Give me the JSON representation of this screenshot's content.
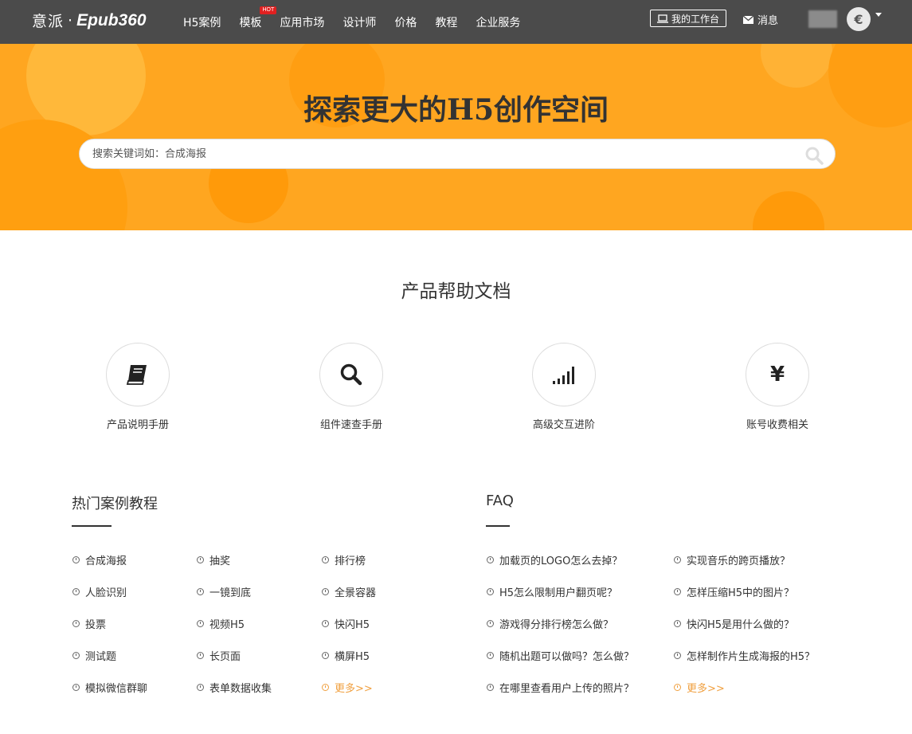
{
  "nav": {
    "logo_cn": "意派",
    "logo_dot": "·",
    "logo_en": "Epub360",
    "items": [
      {
        "label": "H5案例"
      },
      {
        "label": "模板",
        "badge": "HOT"
      },
      {
        "label": "应用市场"
      },
      {
        "label": "设计师"
      },
      {
        "label": "价格"
      },
      {
        "label": "教程"
      },
      {
        "label": "企业服务"
      }
    ],
    "workbench_label": "我的工作台",
    "messages_label": "消息",
    "avatar_letter": "€"
  },
  "hero": {
    "title": "探索更大的H5创作空间",
    "search_placeholder": "搜索关键词如：合成海报",
    "bg_color": "#ffa620"
  },
  "docs": {
    "title": "产品帮助文档",
    "cards": [
      {
        "label": "产品说明手册",
        "icon": "book-icon"
      },
      {
        "label": "组件速查手册",
        "icon": "search-icon"
      },
      {
        "label": "高级交互进阶",
        "icon": "signal-bars-icon"
      },
      {
        "label": "账号收费相关",
        "icon": "yen-icon",
        "glyph": "¥"
      }
    ]
  },
  "tutorials": {
    "title": "热门案例教程",
    "columns": [
      [
        "合成海报",
        "人脸识别",
        "投票",
        "测试题",
        "模拟微信群聊"
      ],
      [
        "抽奖",
        "一镜到底",
        "视频H5",
        "长页面",
        "表单数据收集"
      ],
      [
        "排行榜",
        "全景容器",
        "快闪H5",
        "横屏H5",
        "更多>>"
      ]
    ]
  },
  "faq": {
    "title": "FAQ",
    "columns": [
      [
        "加载页的LOGO怎么去掉？",
        "H5怎么限制用户翻页呢？",
        "游戏得分排行榜怎么做？",
        "随机出题可以做吗？怎么做？",
        "在哪里查看用户上传的照片？"
      ],
      [
        "实现音乐的跨页播放？",
        "怎样压缩H5中的图片？",
        "快闪H5是用什么做的？",
        "怎样制作片生成海报的H5？",
        "更多>>"
      ]
    ]
  },
  "colors": {
    "accent": "#ffa620",
    "more_link": "#f0a040",
    "nav_bg": "#4b4b4b"
  }
}
